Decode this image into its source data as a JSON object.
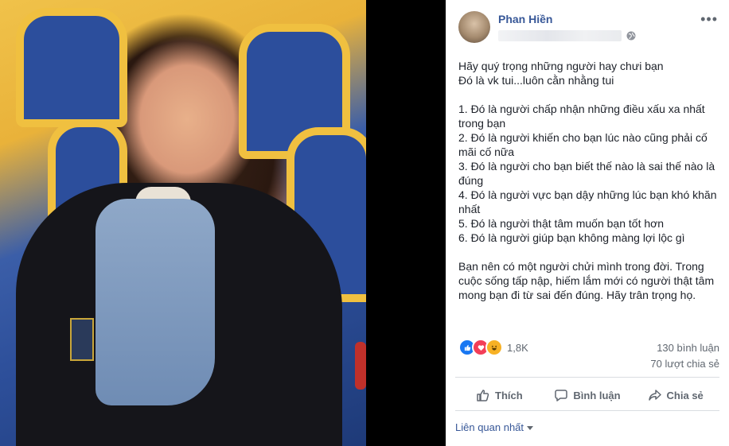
{
  "post": {
    "author": "Phan Hiền",
    "timestamp": "1",
    "privacy_icon": "globe-icon",
    "more_icon": "more-options-icon",
    "more_label": "•••",
    "lines": [
      "Hãy quý trọng những người hay chưi bạn",
      "Đó là vk tui...luôn cằn nhằng tui",
      "",
      "1. Đó là người chấp nhận những điều xấu xa nhất trong bạn",
      "2. Đó là người khiến cho bạn lúc nào cũng phải cố mãi cố nữa",
      "3. Đó là người cho bạn biết thế nào là sai thế nào là đúng",
      "4. Đó là người vực bạn dậy những lúc bạn khó khăn nhất",
      "5. Đó là người thật tâm muốn bạn tốt hơn",
      "6. Đó là người giúp bạn không màng lợi lộc gì",
      "",
      "Bạn nên có một người chửi mình trong đời. Trong cuộc sống tấp nập, hiếm lắm mới có người thật tâm mong bạn đi từ sai đến đúng. Hãy trân trọng họ."
    ]
  },
  "engagement": {
    "reaction_icons": [
      "like-icon",
      "love-icon",
      "haha-icon"
    ],
    "reaction_count": "1,8K",
    "comments": "130 bình luận",
    "shares": "70 lượt chia sẻ"
  },
  "actions": {
    "like": "Thích",
    "comment": "Bình luận",
    "share": "Chia sẻ"
  },
  "comments_sort": "Liên quan nhất",
  "colors": {
    "link": "#385898",
    "muted": "#606770",
    "like": "#1877f2",
    "love": "#f33e58",
    "haha": "#f7b125"
  }
}
